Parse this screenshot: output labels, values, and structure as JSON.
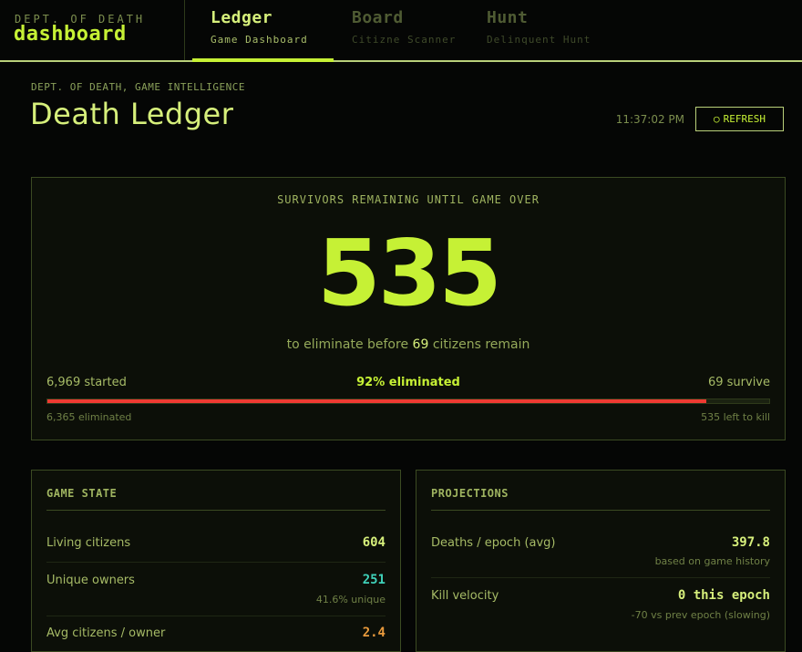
{
  "brand": {
    "small": "DEPT. OF DEATH",
    "big": "dashboard"
  },
  "tabs": [
    {
      "title": "Ledger",
      "subtitle": "Game Dashboard",
      "active": true
    },
    {
      "title": "Board",
      "subtitle": "Citizne Scanner",
      "active": false
    },
    {
      "title": "Hunt",
      "subtitle": "Delinquent Hunt",
      "active": false
    }
  ],
  "header": {
    "eyebrow": "DEPT. OF DEATH, GAME INTELLIGENCE",
    "title": "Death Ledger",
    "time": "11:37:02 PM",
    "refresh_icon": "refresh-icon",
    "refresh_glyph": "○",
    "refresh_label": "REFRESH"
  },
  "hero": {
    "label": "SURVIVORS REMAINING UNTIL GAME OVER",
    "number": "535",
    "sub_pre": "to eliminate before",
    "sub_num": "69",
    "sub_post": "citizens remain",
    "started": "6,969 started",
    "pct": "92% eliminated",
    "survive": "69 survive",
    "eliminated": "6,365 eliminated",
    "left": "535 left to kill",
    "progress_fraction": 0.913,
    "bar_color": "#ef3a32"
  },
  "game_state": {
    "title": "GAME STATE",
    "rows": [
      {
        "label": "Living citizens",
        "value": "604",
        "note": "",
        "color": "#d6ef7b"
      },
      {
        "label": "Unique owners",
        "value": "251",
        "note": "41.6% unique",
        "color": "#3fd1b9"
      },
      {
        "label": "Avg citizens / owner",
        "value": "2.4",
        "note": "",
        "color": "#e89a3c"
      }
    ]
  },
  "projections": {
    "title": "PROJECTIONS",
    "rows": [
      {
        "label": "Deaths / epoch (avg)",
        "value": "397.8",
        "note": "based on game history",
        "color": "#d6ef7b"
      },
      {
        "label": "Kill velocity",
        "value": "0 this epoch",
        "note": "-70 vs prev epoch (slowing)",
        "color": "#d6ef7b"
      }
    ]
  },
  "colors": {
    "accent": "#c6f135",
    "danger": "#ef3a32",
    "teal": "#3fd1b9",
    "orange": "#e89a3c"
  }
}
